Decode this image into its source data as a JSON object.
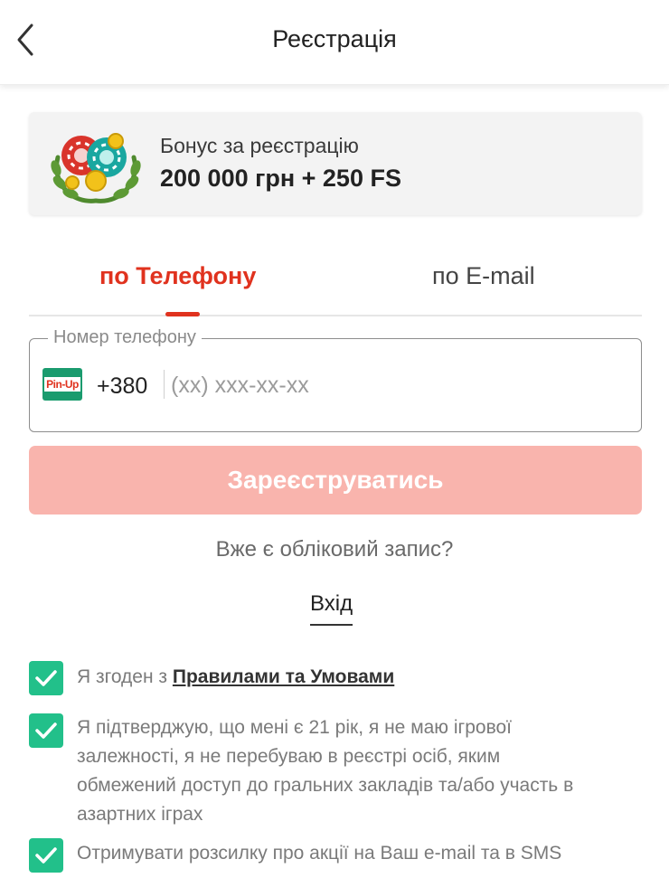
{
  "header": {
    "title": "Реєстрація",
    "back_icon": "chevron-left-icon"
  },
  "bonus": {
    "icon": "casino-chips-wreath-icon",
    "label": "Бонус за реєстрацію",
    "value": "200 000 грн + 250 FS"
  },
  "tabs": [
    {
      "label": "по Телефону",
      "active": true
    },
    {
      "label": "по E-mail",
      "active": false
    }
  ],
  "phone_field": {
    "legend": "Номер телефону",
    "logo_text": "Pin-Up",
    "country_code": "+380",
    "placeholder": "(xx) xxx-xx-xx",
    "value": ""
  },
  "register_button": {
    "label": "Зареєструватись"
  },
  "login": {
    "prompt": "Вже є обліковий запис?",
    "link_label": "Вхід"
  },
  "checkboxes": [
    {
      "checked": true,
      "prefix": "Я згоден з ",
      "link": "Правилами та Умовами"
    },
    {
      "checked": true,
      "line1": "Я підтверджую, що мені є 21 рік, я не маю ігрової",
      "line2": "залежності, я не перебуваю в реєстрі осіб, яким",
      "line3": "обмежений доступ до гральних закладів та/або участь в",
      "line4": "азартних іграх"
    },
    {
      "checked": true,
      "text": "Отримувати розсилку про акції на Ваш e-mail та в SMS"
    }
  ],
  "colors": {
    "accent_red": "#e0321e",
    "button_disabled": "#f9b4ad",
    "checkbox_green": "#22c08a",
    "card_bg": "#f3f3f3"
  }
}
